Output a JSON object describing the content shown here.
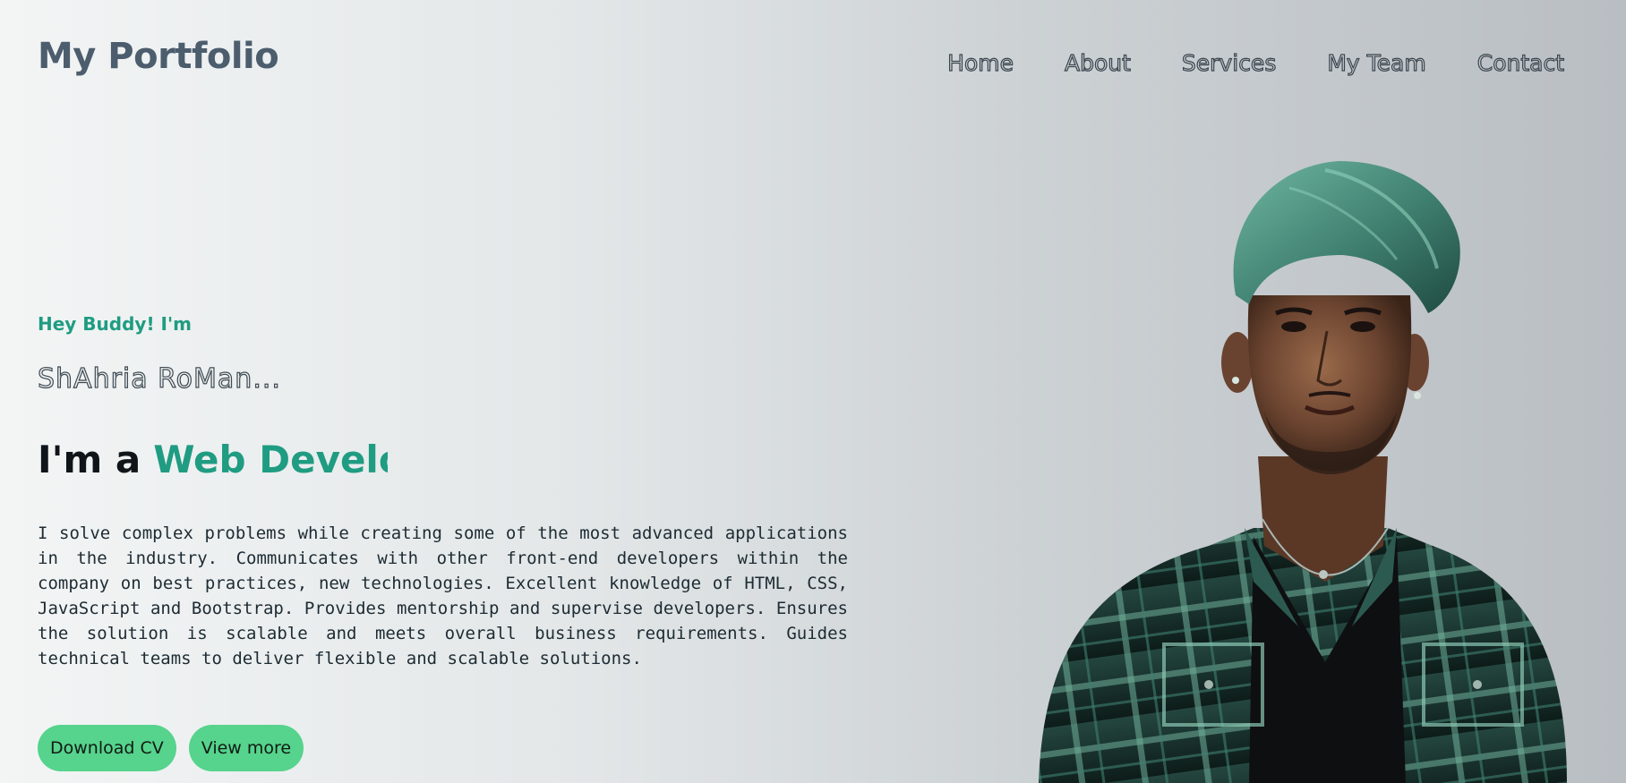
{
  "header": {
    "logo": "My Portfolio",
    "nav": [
      "Home",
      "About",
      "Services",
      "My Team",
      "Contact"
    ]
  },
  "hero": {
    "greeting": "Hey Buddy! I'm",
    "name": "ShAhria RoMan...",
    "role_prefix": "I'm a",
    "role_typed": "Web Develope",
    "bio": "I solve complex problems while creating some of the most advanced applications in the industry. Communicates with other front-end developers within the company on best practices, new technologies. Excellent knowledge of HTML, CSS, JavaScript and Bootstrap. Provides mentorship and supervise developers. Ensures the solution is scalable and meets overall business requirements. Guides technical teams to deliver flexible and scalable solutions.",
    "buttons": {
      "download_cv": "Download CV",
      "view_more": "View more"
    }
  },
  "colors": {
    "accent": "#1f9c82",
    "button": "#56d38c",
    "logo": "#4c5d6d"
  }
}
